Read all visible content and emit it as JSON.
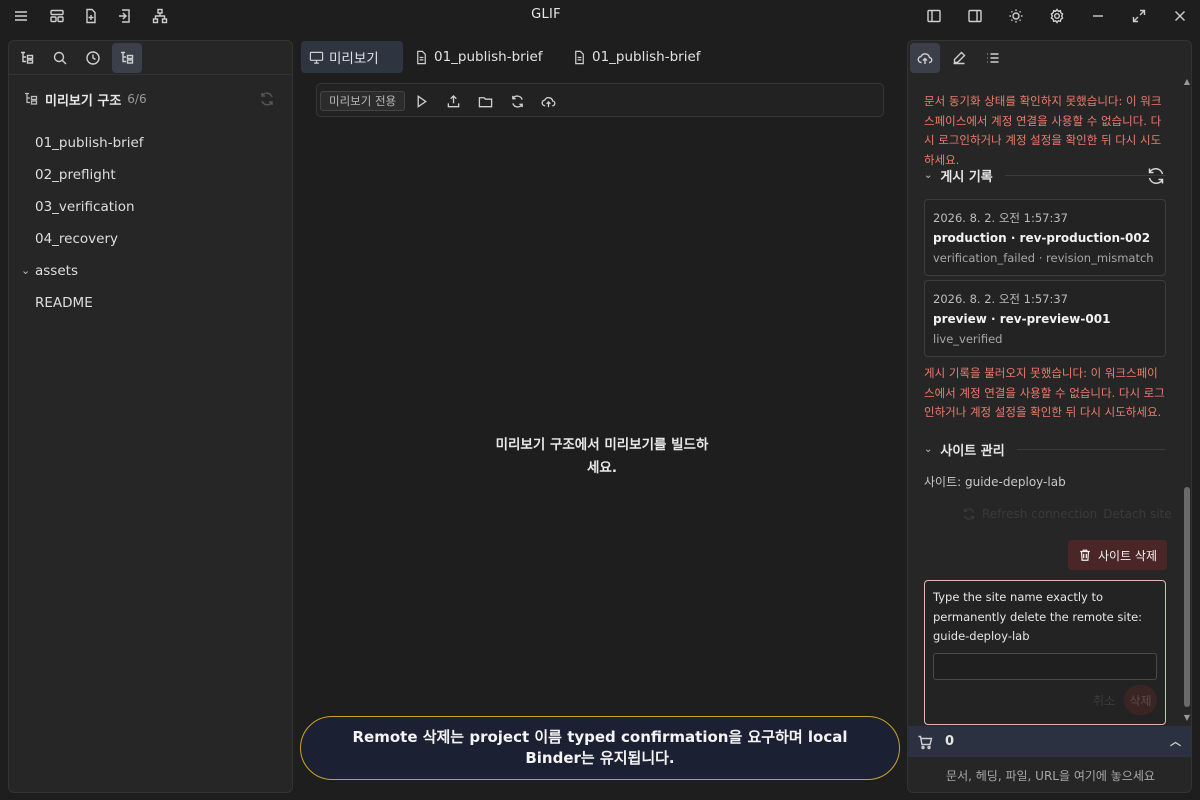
{
  "window": {
    "title": "GLIF"
  },
  "left_panel": {
    "header_title": "미리보기 구조",
    "header_count": "6/6",
    "tree": [
      {
        "label": "01_publish-brief"
      },
      {
        "label": "02_preflight"
      },
      {
        "label": "03_verification"
      },
      {
        "label": "04_recovery"
      },
      {
        "label": "assets",
        "folder": true
      },
      {
        "label": "README"
      }
    ]
  },
  "center": {
    "tabs": [
      {
        "label": "미리보기",
        "icon": "monitor-icon",
        "active": true
      },
      {
        "label": "01_publish-brief",
        "icon": "file-icon"
      },
      {
        "label": "01_publish-brief",
        "icon": "file-icon"
      }
    ],
    "preview_only_badge": "미리보기 전용",
    "empty_message": "미리보기 구조에서 미리보기를 빌드하세요."
  },
  "right_panel": {
    "sync_error": "문서 동기화 상태를 확인하지 못했습니다: 이 워크스페이스에서 계정 연결을 사용할 수 없습니다. 다시 로그인하거나 계정 설정을 확인한 뒤 다시 시도하세요.",
    "history_title": "게시 기록",
    "history": [
      {
        "date": "2026. 8. 2. 오전 1:57:37",
        "name": "production · rev-production-002",
        "status": "verification_failed · revision_mismatch"
      },
      {
        "date": "2026. 8. 2. 오전 1:57:37",
        "name": "preview · rev-preview-001",
        "status": "live_verified"
      }
    ],
    "history_error": "게시 기록을 불러오지 못했습니다: 이 워크스페이스에서 계정 연결을 사용할 수 없습니다. 다시 로그인하거나 계정 설정을 확인한 뒤 다시 시도하세요.",
    "site_title": "사이트 관리",
    "site_label": "사이트: guide-deploy-lab",
    "refresh_connection": "Refresh connection",
    "detach_site": "Detach site",
    "delete_site_button": "사이트 삭제",
    "confirm_text": "Type the site name exactly to permanently delete the remote site: guide-deploy-lab",
    "confirm_input_value": "",
    "cancel_label": "취소",
    "confirm_delete_label": "삭제",
    "cart_count": "0",
    "drop_hint": "문서, 헤딩, 파일, URL을 여기에 놓으세요"
  },
  "toast": {
    "message": "Remote 삭제는 project 이름 typed confirmation을 요구하며 local Binder는 유지됩니다."
  },
  "colors": {
    "error": "#ef7a6e",
    "toast_border": "#c9a227",
    "toast_bg": "#1b2033",
    "active_tab": "#2e3440",
    "danger_button": "#4a2626"
  }
}
